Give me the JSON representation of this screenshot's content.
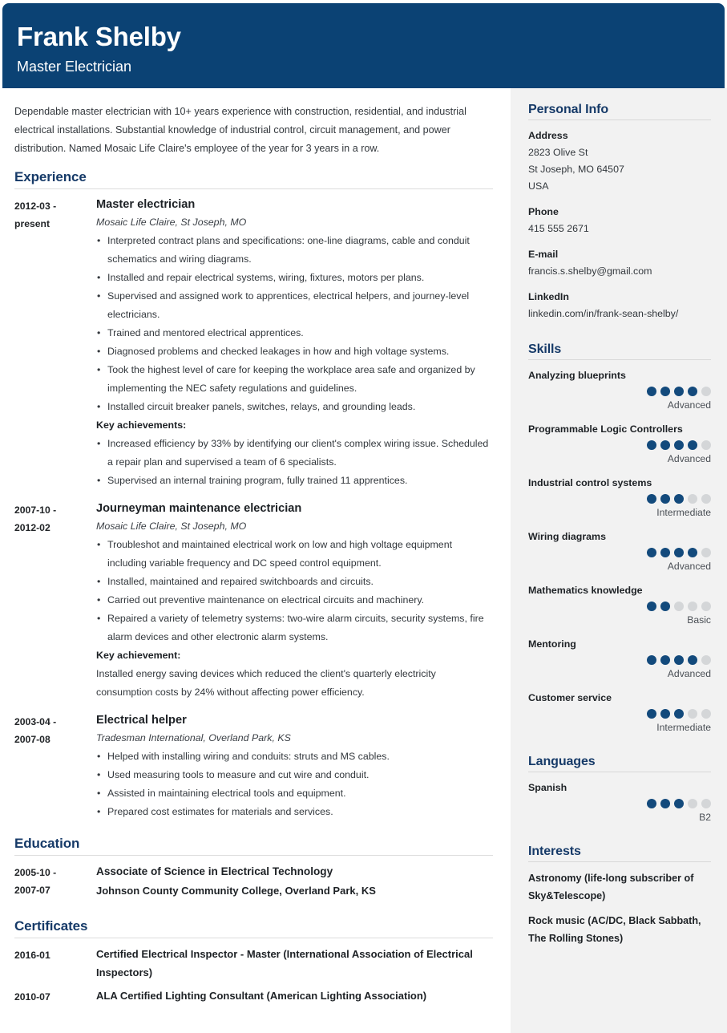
{
  "header": {
    "name": "Frank Shelby",
    "title": "Master Electrician",
    "background_color": "#0b4274"
  },
  "theme": {
    "accent": "#163a68",
    "dot_filled": "#134a7c",
    "dot_empty": "#d4d6d8",
    "sidebar_background": "#f2f2f2"
  },
  "main": {
    "summary": "Dependable master electrician with 10+ years experience with construction, residential, and industrial electrical installations. Substantial knowledge of industrial control, circuit management, and power distribution. Named Mosaic Life Claire's employee of the year for 3 years in a row.",
    "sections": {
      "experience_heading": "Experience",
      "education_heading": "Education",
      "certificates_heading": "Certificates"
    },
    "experience": [
      {
        "date": "2012-03 -\npresent",
        "date_line1": "2012-03 -",
        "date_line2": "present",
        "title": "Master electrician",
        "company": "Mosaic Life Claire, St Joseph, MO",
        "bullets": [
          "Interpreted contract plans and specifications: one-line diagrams, cable and conduit schematics and wiring diagrams.",
          "Installed and repair electrical systems, wiring, fixtures, motors per plans.",
          "Supervised and assigned work to apprentices, electrical helpers, and journey-level electricians.",
          "Trained and mentored electrical apprentices.",
          "Diagnosed problems and checked leakages in how and high voltage systems.",
          "Took the highest level of care for keeping the workplace area safe and organized by implementing the NEC safety regulations and guidelines.",
          "Installed circuit breaker panels, switches, relays, and grounding leads."
        ],
        "achievement_label": "Key achievements:",
        "achievement_bullets": [
          "Increased efficiency by 33% by identifying our client's complex wiring issue. Scheduled a repair plan and supervised a team of 6 specialists.",
          "Supervised an internal training program, fully trained 11 apprentices."
        ],
        "achievement_text": ""
      },
      {
        "date_line1": "2007-10 -",
        "date_line2": "2012-02",
        "title": "Journeyman maintenance electrician",
        "company": "Mosaic Life Claire, St Joseph, MO",
        "bullets": [
          "Troubleshot and maintained electrical work on low and high voltage equipment including variable frequency and DC speed control equipment.",
          "Installed, maintained and repaired switchboards and circuits.",
          "Carried out preventive maintenance on electrical circuits and machinery.",
          "Repaired a variety of telemetry systems: two-wire alarm circuits, security systems, fire alarm devices and other electronic alarm systems."
        ],
        "achievement_label": "Key achievement:",
        "achievement_bullets": [],
        "achievement_text": "Installed energy saving devices which reduced the client's quarterly electricity consumption costs by 24% without affecting power efficiency."
      },
      {
        "date_line1": "2003-04 -",
        "date_line2": "2007-08",
        "title": "Electrical helper",
        "company": "Tradesman International, Overland Park, KS",
        "bullets": [
          "Helped with installing wiring and conduits: struts and MS cables.",
          "Used measuring tools to measure and cut wire and conduit.",
          "Assisted in maintaining electrical tools and equipment.",
          "Prepared cost estimates for materials and services."
        ],
        "achievement_label": "",
        "achievement_bullets": [],
        "achievement_text": ""
      }
    ],
    "education": [
      {
        "date_line1": "2005-10 -",
        "date_line2": "2007-07",
        "degree": "Associate of Science in Electrical Technology",
        "school": "Johnson County Community College, Overland Park, KS"
      }
    ],
    "certificates": [
      {
        "date": "2016-01",
        "name": "Certified Electrical Inspector - Master (International Association of Electrical Inspectors)"
      },
      {
        "date": "2010-07",
        "name": "ALA Certified Lighting Consultant (American Lighting Association)"
      }
    ]
  },
  "sidebar": {
    "personal_info": {
      "heading": "Personal Info",
      "items": [
        {
          "label": "Address",
          "values": [
            "2823 Olive St",
            "St Joseph, MO 64507",
            "USA"
          ]
        },
        {
          "label": "Phone",
          "values": [
            "415 555 2671"
          ]
        },
        {
          "label": "E-mail",
          "values": [
            "francis.s.shelby@gmail.com"
          ]
        },
        {
          "label": "LinkedIn",
          "values": [
            "linkedin.com/in/frank-sean-shelby/"
          ]
        }
      ]
    },
    "skills": {
      "heading": "Skills",
      "max_dots": 5,
      "items": [
        {
          "name": "Analyzing blueprints",
          "rating": 4,
          "level": "Advanced"
        },
        {
          "name": "Programmable Logic Controllers",
          "rating": 4,
          "level": "Advanced"
        },
        {
          "name": "Industrial control systems",
          "rating": 3,
          "level": "Intermediate"
        },
        {
          "name": "Wiring diagrams",
          "rating": 4,
          "level": "Advanced"
        },
        {
          "name": "Mathematics knowledge",
          "rating": 2,
          "level": "Basic"
        },
        {
          "name": "Mentoring",
          "rating": 4,
          "level": "Advanced"
        },
        {
          "name": "Customer service",
          "rating": 3,
          "level": "Intermediate"
        }
      ]
    },
    "languages": {
      "heading": "Languages",
      "max_dots": 5,
      "items": [
        {
          "name": "Spanish",
          "rating": 3,
          "level": "B2"
        }
      ]
    },
    "interests": {
      "heading": "Interests",
      "items": [
        "Astronomy (life-long subscriber of Sky&Telescope)",
        "Rock music (AC/DC, Black Sabbath, The Rolling Stones)"
      ]
    }
  }
}
